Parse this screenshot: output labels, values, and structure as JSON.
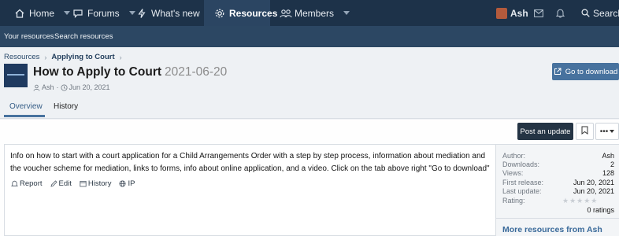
{
  "nav": {
    "items": [
      {
        "label": "Home",
        "icon": "home-icon"
      },
      {
        "label": "Forums",
        "icon": "chat-icon"
      },
      {
        "label": "What's new",
        "icon": "bolt-icon"
      },
      {
        "label": "Resources",
        "icon": "gear-icon"
      },
      {
        "label": "Members",
        "icon": "users-icon"
      }
    ],
    "active": "Resources",
    "user": "Ash",
    "search_label": "Search"
  },
  "subnav": {
    "items": [
      "Your resources",
      "Search resources"
    ]
  },
  "breadcrumb": [
    "Resources",
    "Applying to Court"
  ],
  "resource": {
    "title": "How to Apply to Court",
    "version": "2021-06-20",
    "author": "Ash",
    "date": "Jun 20, 2021"
  },
  "download_button": "Go to download",
  "tabs": [
    "Overview",
    "History"
  ],
  "buttons": {
    "post_update": "Post an update",
    "more": "•••"
  },
  "description": "Info on how to start with a court application for a Child Arrangements Order with a step by step process, information about mediation and the voucher scheme for mediation, links to forms, info about online application, and a video. Click on the tab above right \"Go to download\"",
  "post_actions": [
    "Report",
    "Edit",
    "History",
    "IP"
  ],
  "info": {
    "rows": [
      {
        "label": "Author:",
        "value": "Ash"
      },
      {
        "label": "Downloads:",
        "value": "2"
      },
      {
        "label": "Views:",
        "value": "128"
      },
      {
        "label": "First release:",
        "value": "Jun 20, 2021"
      },
      {
        "label": "Last update:",
        "value": "Jun 20, 2021"
      },
      {
        "label": "Rating:",
        "value": ""
      }
    ],
    "rating_stars": 0,
    "ratings_text": "0 ratings",
    "more_resources": "More resources from Ash"
  },
  "colors": {
    "nav_bg": "#1d3249",
    "subnav_bg": "#2c4763",
    "accent": "#47729e",
    "primary_button": "#243444"
  }
}
